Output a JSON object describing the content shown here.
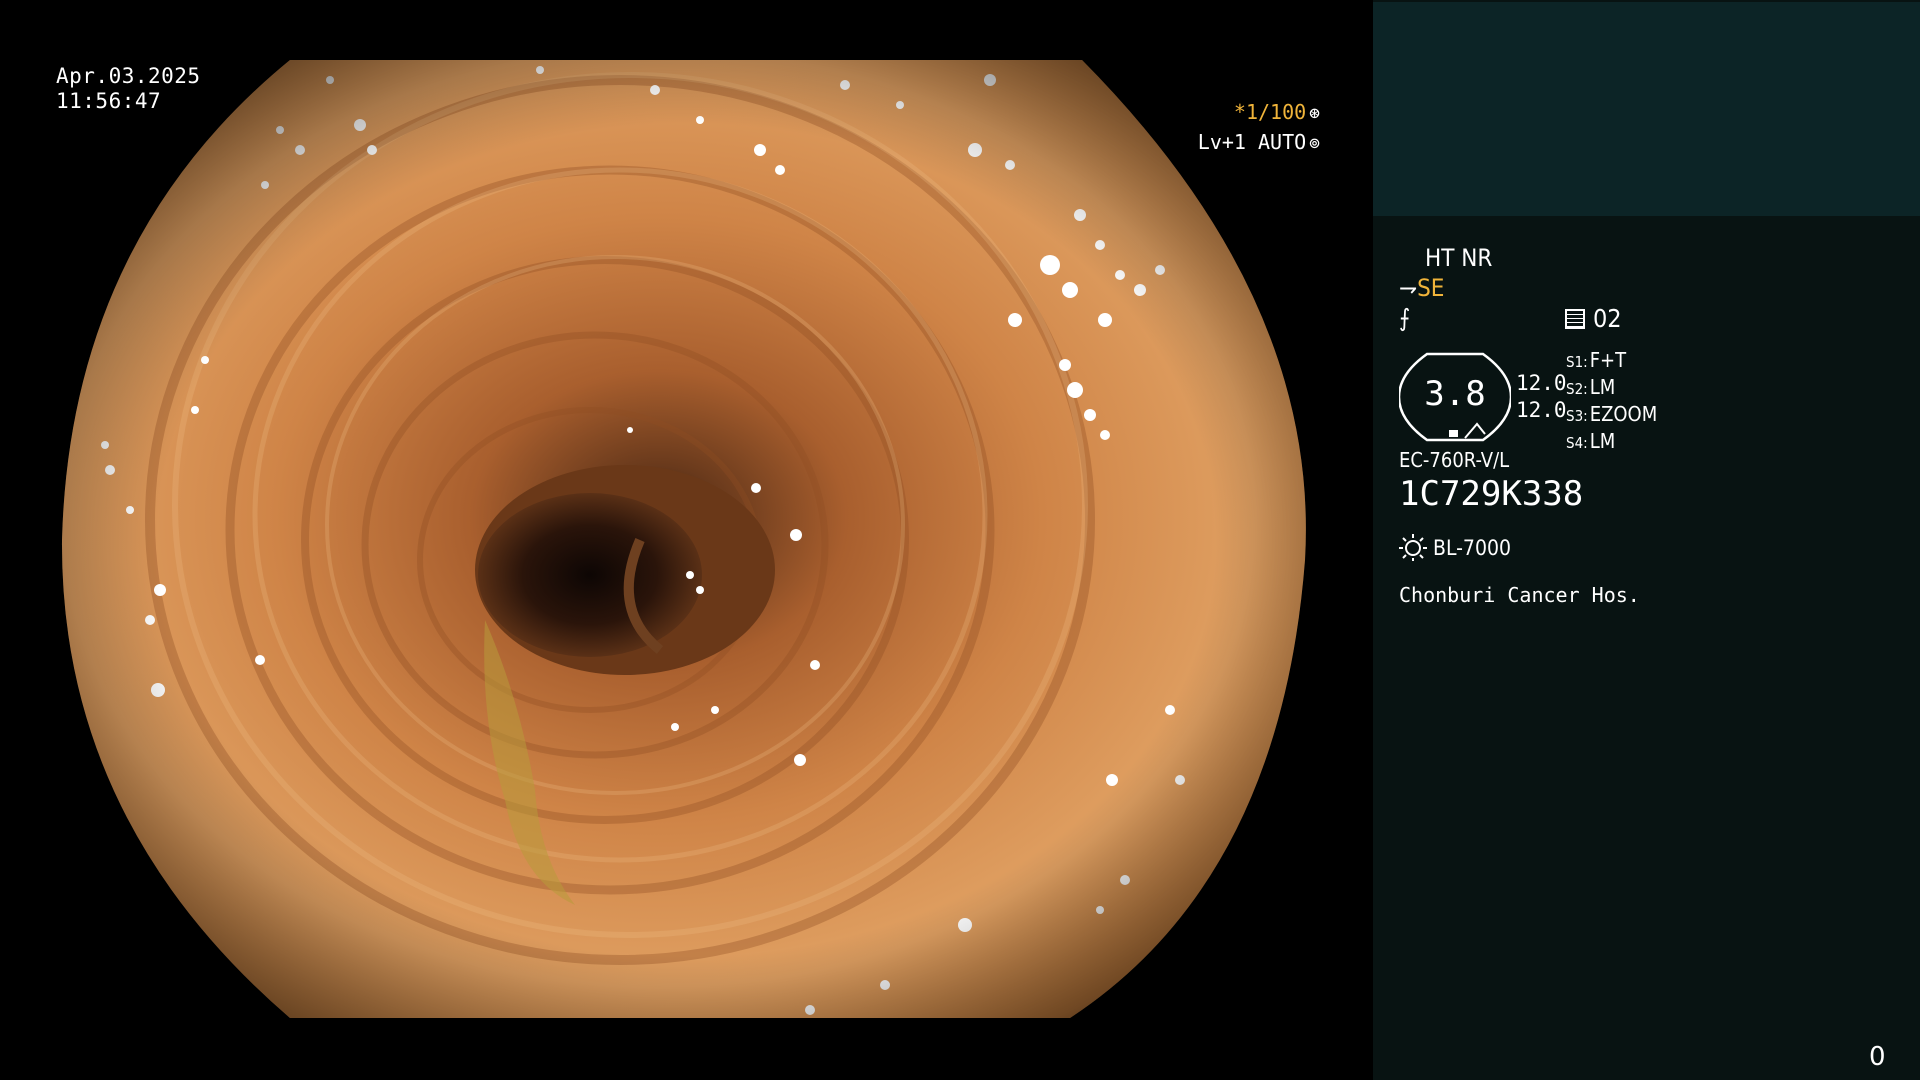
{
  "image": {
    "date": "Apr.03.2025",
    "time": "11:56:47",
    "shutter": "*1/100",
    "shutter_icon": "shutter-icon",
    "iris": "Lv+1 AUTO",
    "iris_icon": "iris-icon"
  },
  "panel": {
    "modes": "HT NR",
    "enhance_label": "SE",
    "enhance_icon": "enhance-icon",
    "color_icon": "color-icon",
    "channel": "02",
    "channel_icon": "channel-icon",
    "zoom_value": "3.8",
    "gauge_values": [
      "12.0",
      "12.0"
    ],
    "settings": [
      {
        "key": "S1:",
        "value": "F+T"
      },
      {
        "key": "S2:",
        "value": "LM"
      },
      {
        "key": "S3:",
        "value": "EZOOM"
      },
      {
        "key": "S4:",
        "value": "LM"
      }
    ],
    "scope_model": "EC-760R-V/L",
    "scope_serial": "1C729K338",
    "light_source": "BL-7000",
    "light_icon": "light-source-icon",
    "hospital": "Chonburi Cancer Hos.",
    "counter": "0"
  },
  "colors": {
    "accent": "#f0b43a",
    "panel_bg": "#081312",
    "panel_top": "#0c2426"
  }
}
